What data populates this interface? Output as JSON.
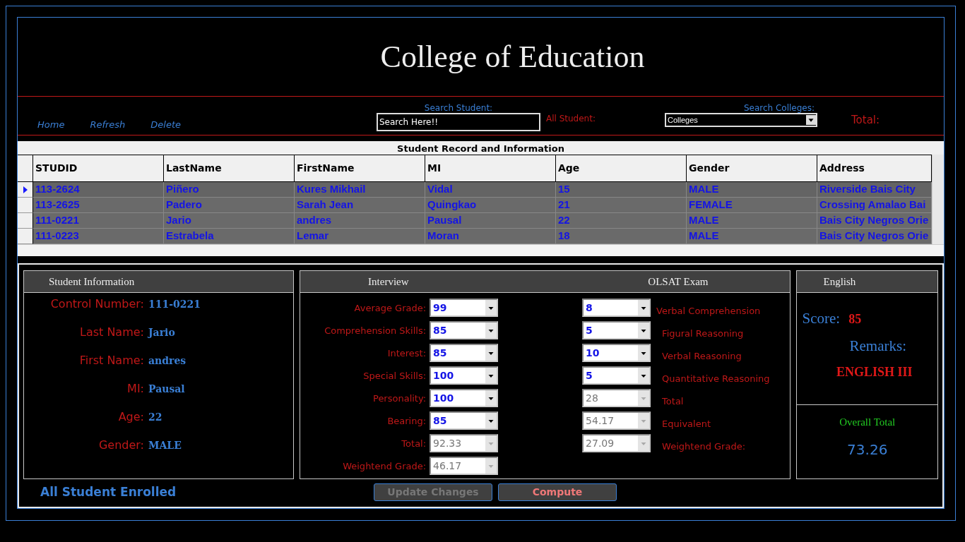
{
  "title": "College of Education",
  "toolbar": {
    "links": [
      "Home",
      "Refresh",
      "Delete"
    ],
    "search_label": "Search Student:",
    "search": {
      "value": "Search Here!!"
    },
    "all_student_label": "All Student:",
    "colleges_label": "Search Colleges:",
    "colleges": {
      "value": "Colleges"
    },
    "total_label": "Total:"
  },
  "grid": {
    "caption": "Student Record and Information",
    "columns": [
      "STUDID",
      "LastName",
      "FirstName",
      "MI",
      "Age",
      "Gender",
      "Address"
    ],
    "rows": [
      {
        "selected": true,
        "cells": [
          "113-2624",
          "Piñero",
          "Kures Mikhail",
          "Vidal",
          "15",
          "MALE",
          "Riverside Bais City"
        ]
      },
      {
        "selected": false,
        "cells": [
          "113-2625",
          "Padero",
          "Sarah Jean",
          "Quingkao",
          "21",
          "FEMALE",
          "Crossing Amalao Bai"
        ]
      },
      {
        "selected": false,
        "cells": [
          "111-0221",
          "Jario",
          "andres",
          "Pausal",
          "22",
          "MALE",
          "Bais City  Negros Orie"
        ]
      },
      {
        "selected": false,
        "cells": [
          "111-0223",
          "Estrabela",
          "Lemar",
          "Moran",
          "18",
          "MALE",
          "Bais City Negros Orie"
        ]
      }
    ]
  },
  "student_info": {
    "title": "Student Information",
    "fields": [
      {
        "label": "Control Number:",
        "value": "111-0221"
      },
      {
        "label": "Last Name:",
        "value": "Jario"
      },
      {
        "label": "First Name:",
        "value": "andres"
      },
      {
        "label": "MI:",
        "value": "Pausal"
      },
      {
        "label": "Age:",
        "value": "22"
      },
      {
        "label": "Gender:",
        "value": "MALE"
      }
    ]
  },
  "interview": {
    "title": "Interview",
    "fields": [
      {
        "label": "Average Grade:",
        "value": "99",
        "disabled": false
      },
      {
        "label": "Comprehension Skills:",
        "value": "85",
        "disabled": false
      },
      {
        "label": "Interest:",
        "value": "85",
        "disabled": false
      },
      {
        "label": "Special Skills:",
        "value": "100",
        "disabled": false
      },
      {
        "label": "Personality:",
        "value": "100",
        "disabled": false
      },
      {
        "label": "Bearing:",
        "value": "85",
        "disabled": false
      },
      {
        "label": "Total:",
        "value": "92.33",
        "disabled": true
      },
      {
        "label": "Weightend Grade:",
        "value": "46.17",
        "disabled": true
      }
    ]
  },
  "olsat": {
    "title": "OLSAT Exam",
    "fields": [
      {
        "value": "8",
        "label": "Verbal Comprehension",
        "disabled": false
      },
      {
        "value": "5",
        "label": "Figural Reasoning",
        "disabled": false
      },
      {
        "value": "10",
        "label": "Verbal Reasoning",
        "disabled": false
      },
      {
        "value": "5",
        "label": "Quantitative Reasoning",
        "disabled": false
      },
      {
        "value": "28",
        "label": "Total",
        "disabled": true
      },
      {
        "value": "54.17",
        "label": "Equivalent",
        "disabled": true
      },
      {
        "value": "27.09",
        "label": "Weightend Grade:",
        "disabled": true
      }
    ]
  },
  "english": {
    "title": "English",
    "score_label": "Score:",
    "score": "85",
    "remarks_label": "Remarks:",
    "remarks": "ENGLISH III",
    "overall_label": "Overall Total",
    "overall": "73.26"
  },
  "status": "All Student Enrolled",
  "buttons": [
    {
      "label": "Update Changes",
      "disabled": true
    },
    {
      "label": "Compute",
      "disabled": false
    }
  ]
}
